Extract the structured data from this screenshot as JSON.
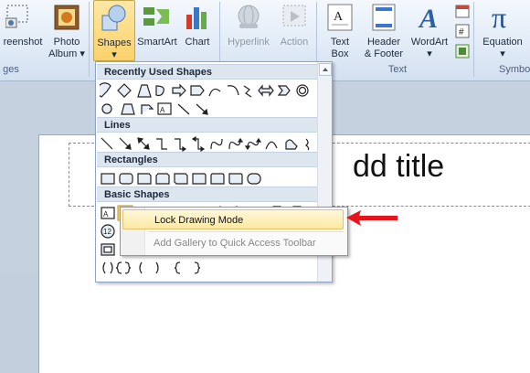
{
  "ribbon": {
    "buttons": [
      {
        "id": "screenshot",
        "label1": "reenshot",
        "label2": ""
      },
      {
        "id": "photo",
        "label1": "Photo",
        "label2": "Album ▾"
      },
      {
        "id": "shapes",
        "label1": "Shapes",
        "label2": "▾"
      },
      {
        "id": "smartart",
        "label1": "SmartArt",
        "label2": ""
      },
      {
        "id": "chart",
        "label1": "Chart",
        "label2": ""
      },
      {
        "id": "hyperlink",
        "label1": "Hyperlink",
        "label2": ""
      },
      {
        "id": "action",
        "label1": "Action",
        "label2": ""
      },
      {
        "id": "textbox",
        "label1": "Text",
        "label2": "Box"
      },
      {
        "id": "headerfooter",
        "label1": "Header",
        "label2": "& Footer"
      },
      {
        "id": "wordart",
        "label1": "WordArt",
        "label2": "▾"
      },
      {
        "id": "equation",
        "label1": "Equation",
        "label2": "▾"
      }
    ],
    "groups": {
      "images": "ges",
      "text": "Text",
      "symbols": "Symbo"
    }
  },
  "slide": {
    "title_placeholder": "dd title"
  },
  "shapes_gallery": {
    "categories": [
      "Recently Used Shapes",
      "Lines",
      "Rectangles",
      "Basic Shapes"
    ]
  },
  "context_menu": {
    "items": [
      {
        "label": "Lock Drawing Mode",
        "state": "highlighted"
      },
      {
        "label": "Add Gallery to Quick Access Toolbar",
        "state": "disabled"
      }
    ]
  },
  "colors": {
    "accent_red": "#e8141b",
    "ribbon_active": "#fbd16a"
  }
}
